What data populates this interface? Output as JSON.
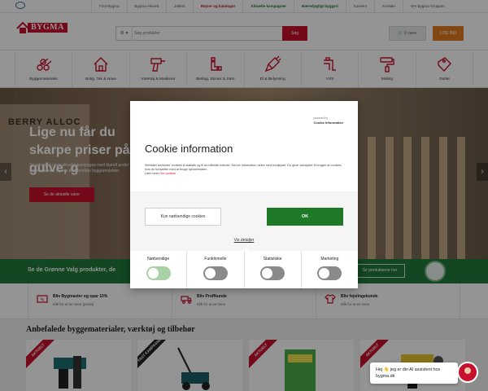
{
  "topbar": {
    "links": [
      {
        "label": "Find Bygma",
        "style": "normal"
      },
      {
        "label": "Bygma Aktuelt",
        "style": "normal"
      },
      {
        "label": "Jobbet",
        "style": "normal"
      },
      {
        "label": "Rejser og kataloger",
        "style": "red"
      },
      {
        "label": "Aktuelle kampagner",
        "style": "green"
      },
      {
        "label": "Bæredygtigt byggeri",
        "style": "green"
      },
      {
        "label": "Karriere",
        "style": "normal"
      },
      {
        "label": "Kontakt",
        "style": "normal"
      },
      {
        "label": "Om Bygma Gruppen",
        "style": "normal"
      }
    ]
  },
  "header": {
    "logo_text": "BYGMA",
    "search_placeholder": "Søg produkter",
    "search_button": "Søg",
    "cart_label": "0 varer",
    "login_label": "LOG IND"
  },
  "categories": [
    {
      "label": "Byggematerialer",
      "icon": "lumber-icon"
    },
    {
      "label": "Bolig, Tek & Have",
      "icon": "house-icon"
    },
    {
      "label": "Værktøj & Maskiner",
      "icon": "drill-icon"
    },
    {
      "label": "Beslag, Skruer & Søm",
      "icon": "bracket-icon"
    },
    {
      "label": "El & Belysning",
      "icon": "plug-icon"
    },
    {
      "label": "VVS",
      "icon": "pipe-icon"
    },
    {
      "label": "Maling",
      "icon": "paint-roller-icon"
    },
    {
      "label": "Outlet",
      "icon": "outlet-tag-icon"
    }
  ],
  "hero": {
    "brand_text": "BERRY ALLOC",
    "title": "Lige nu får du skarpe priser på gulve, g",
    "subtitle": "Se udvalget i den aktuelle kampagne med blandt andet gulve, paneler og træ til indendørs byggeprojekter",
    "cta": "Se de aktuelle varer"
  },
  "green_banner": {
    "text": "Se de Grønne Valg produkter, de",
    "button": "Se produkterne her"
  },
  "benefits": [
    {
      "title": "Bliv Bygmaster og spar 10%",
      "sub": "Klik for at se mere (privat)"
    },
    {
      "title": "Bliv Proffkunde",
      "sub": "Klik for at se mere"
    },
    {
      "title": "Bliv fejelingskunde",
      "sub": "Klik for at se mere"
    }
  ],
  "section_title": "Anbefalede byggematerialer, værktøj og tilbehør",
  "products": [
    {
      "ribbon": "AKTUELT",
      "ribbon_style": "red"
    },
    {
      "ribbon": "FAST KAMPAGNE",
      "ribbon_style": "dark"
    },
    {
      "ribbon": "AKTUELT",
      "ribbon_style": "red"
    },
    {
      "ribbon": "AKTUELT",
      "ribbon_style": "red"
    }
  ],
  "cookie": {
    "powered_by": "powered by",
    "powered_name": "Cookie Information",
    "title": "Cookie information",
    "description": "Websitet anvender cookies til statistik og til at målrette indhold. Denne information deles med tredjepart. Du giver samtykke til brugen af cookies, hvis du fortsætter med at bruge hjemmesiden.",
    "read_more": "Læs mere",
    "read_more_link": "Om cookies",
    "btn_necessary": "Kun nødvendige cookies",
    "btn_ok": "OK",
    "details_link": "Vis detaljer",
    "categories": [
      {
        "label": "Nødvendige",
        "enabled": true
      },
      {
        "label": "Funktionelle",
        "enabled": false
      },
      {
        "label": "Statistiske",
        "enabled": false
      },
      {
        "label": "Marketing",
        "enabled": false
      }
    ]
  },
  "chat": {
    "message": "Hej 👋 jeg er din AI assistent hos bygma.dk"
  },
  "colors": {
    "brand_red": "#c8102e",
    "green": "#1f7a27",
    "orange": "#e07a1f"
  }
}
